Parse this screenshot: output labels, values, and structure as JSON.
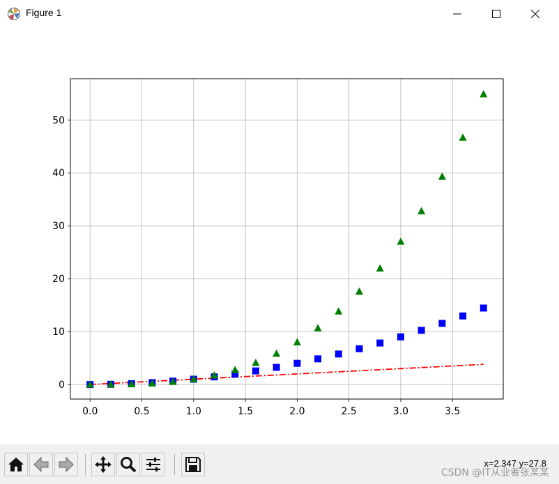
{
  "window": {
    "title": "Figure 1",
    "icons": {
      "app": "matplotlib-icon",
      "minimize": "minimize-icon",
      "maximize": "maximize-icon",
      "close": "close-icon"
    }
  },
  "toolbar": {
    "buttons": [
      "home-icon",
      "back-arrow-icon",
      "forward-arrow-icon",
      "pan-move-icon",
      "zoom-magnifier-icon",
      "configure-subplots-icon",
      "save-disk-icon"
    ],
    "coords": "x=2.347  y=27.8",
    "watermark": "CSDN @IT从业者张某某"
  },
  "chart_data": {
    "type": "scatter",
    "grid": true,
    "xlim": [
      -0.19,
      3.99
    ],
    "ylim": [
      -2.75,
      57.8
    ],
    "xticks": [
      0.0,
      0.5,
      1.0,
      1.5,
      2.0,
      2.5,
      3.0,
      3.5
    ],
    "xtick_labels": [
      "0.0",
      "0.5",
      "1.0",
      "1.5",
      "2.0",
      "2.5",
      "3.0",
      "3.5"
    ],
    "yticks": [
      0,
      10,
      20,
      30,
      40,
      50
    ],
    "ytick_labels": [
      "0",
      "10",
      "20",
      "30",
      "40",
      "50"
    ],
    "x": [
      0.0,
      0.2,
      0.4,
      0.6,
      0.8,
      1.0,
      1.2,
      1.4,
      1.6,
      1.8,
      2.0,
      2.2,
      2.4,
      2.6,
      2.8,
      3.0,
      3.2,
      3.4,
      3.6,
      3.8
    ],
    "series": [
      {
        "style": "dashdot-line",
        "color": "#ff0000",
        "values": [
          0.0,
          0.2,
          0.4,
          0.6,
          0.8,
          1.0,
          1.2,
          1.4,
          1.6,
          1.8,
          2.0,
          2.2,
          2.4,
          2.6,
          2.8,
          3.0,
          3.2,
          3.4,
          3.6,
          3.8
        ]
      },
      {
        "style": "square-marker",
        "color": "#0000ff",
        "values": [
          0.0,
          0.04,
          0.16,
          0.36,
          0.64,
          1.0,
          1.44,
          1.96,
          2.56,
          3.24,
          4.0,
          4.84,
          5.76,
          6.76,
          7.84,
          9.0,
          10.24,
          11.56,
          12.96,
          14.44
        ]
      },
      {
        "style": "triangle-marker",
        "color": "#008000",
        "values": [
          0.0,
          0.008,
          0.064,
          0.216,
          0.512,
          1.0,
          1.728,
          2.744,
          4.096,
          5.832,
          8.0,
          10.648,
          13.824,
          17.576,
          21.952,
          27.0,
          32.768,
          39.304,
          46.656,
          54.872
        ]
      }
    ]
  }
}
